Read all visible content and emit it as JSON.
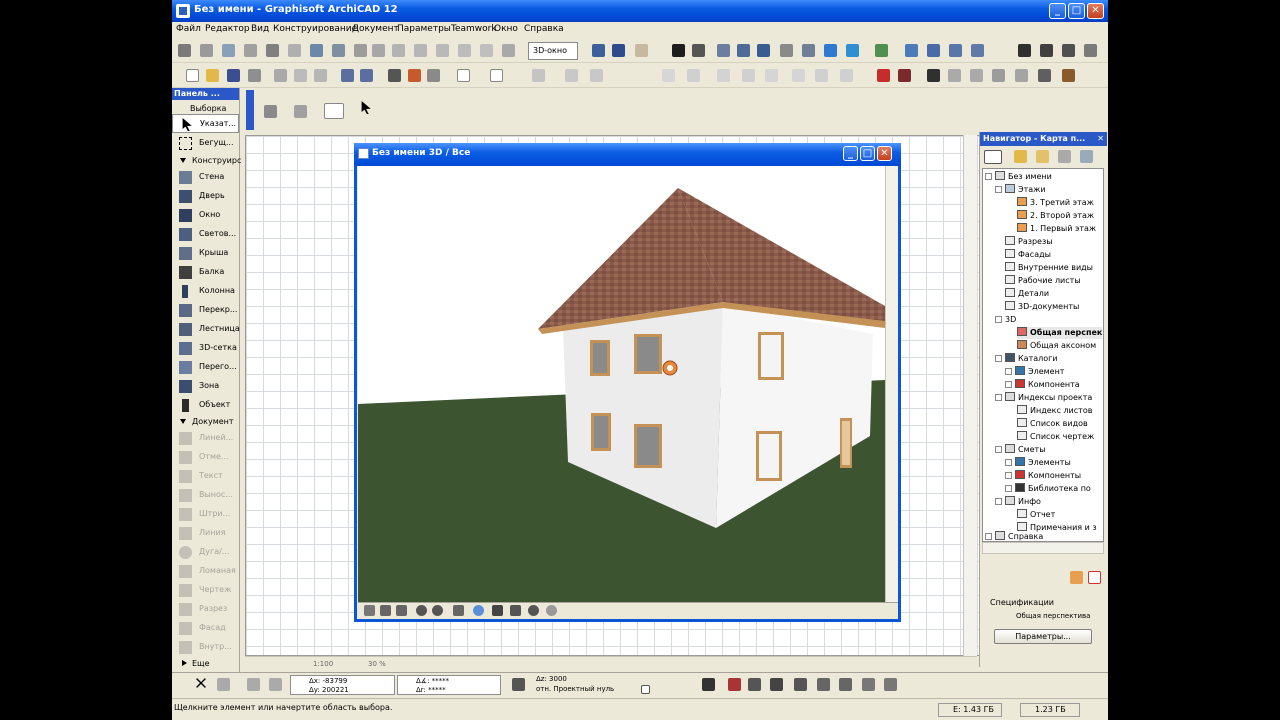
{
  "window": {
    "title": "Без имени - Graphisoft ArchiCAD 12",
    "minimize": "_",
    "maximize": "□",
    "close": "✕"
  },
  "menu": [
    "Файл",
    "Редактор",
    "Вид",
    "Конструирование",
    "Документ",
    "Параметры",
    "Teamwork",
    "Окно",
    "Справка"
  ],
  "toolbar": {
    "view3d_label": "3D-окно"
  },
  "toolbox": {
    "header": "Панель ...",
    "selection_section": "Выборка",
    "pointer": "Указат...",
    "marquee": "Бегущ...",
    "design_section": "Конструирс",
    "design_tools": [
      "Стена",
      "Дверь",
      "Окно",
      "Светов...",
      "Крыша",
      "Балка",
      "Колонна",
      "Перекр...",
      "Лестница",
      "3D-сетка",
      "Перего...",
      "Зона",
      "Объект"
    ],
    "document_section": "Документ",
    "document_tools": [
      "Линей...",
      "Отме...",
      "Текст",
      "Вынос...",
      "Штри...",
      "Линия",
      "Дуга/...",
      "Ломаная",
      "Чертеж",
      "Разрез",
      "Фасад",
      "Внутр..."
    ],
    "more_section": "Еще"
  },
  "window3d": {
    "title": "Без имени 3D / Все",
    "minimize": "_",
    "maximize": "□",
    "close": "✕"
  },
  "plan": {
    "scale": "1:100",
    "zoom": "30 %"
  },
  "navigator": {
    "header": "Навигатор - Карта п...",
    "close": "✕",
    "tree": [
      {
        "label": "Без имени",
        "level": 0
      },
      {
        "label": "Этажи",
        "level": 1
      },
      {
        "label": "3. Третий этаж",
        "level": 2
      },
      {
        "label": "2. Второй этаж",
        "level": 2
      },
      {
        "label": "1. Первый этаж",
        "level": 2
      },
      {
        "label": "Разрезы",
        "level": 1
      },
      {
        "label": "Фасады",
        "level": 1
      },
      {
        "label": "Внутренние виды",
        "level": 1
      },
      {
        "label": "Рабочие листы",
        "level": 1
      },
      {
        "label": "Детали",
        "level": 1
      },
      {
        "label": "3D-документы",
        "level": 1
      },
      {
        "label": "3D",
        "level": 1
      },
      {
        "label": "Общая перспек",
        "level": 2
      },
      {
        "label": "Общая аксоном",
        "level": 2
      },
      {
        "label": "Каталоги",
        "level": 1
      },
      {
        "label": "Элемент",
        "level": 2
      },
      {
        "label": "Компонента",
        "level": 2
      },
      {
        "label": "Индексы проекта",
        "level": 1
      },
      {
        "label": "Индекс листов",
        "level": 2
      },
      {
        "label": "Список видов",
        "level": 2
      },
      {
        "label": "Список чертеж",
        "level": 2
      },
      {
        "label": "Сметы",
        "level": 1
      },
      {
        "label": "Элементы",
        "level": 2
      },
      {
        "label": "Компоненты",
        "level": 2
      },
      {
        "label": "Библиотека по",
        "level": 2
      },
      {
        "label": "Инфо",
        "level": 1
      },
      {
        "label": "Отчет",
        "level": 2
      },
      {
        "label": "Примечания и з",
        "level": 2
      },
      {
        "label": "Справка",
        "level": 0
      }
    ],
    "section_label": "Спецификации",
    "selected_view": "Общая перспектива",
    "params_button": "Параметры..."
  },
  "coords": {
    "dx": "Δx: -83799",
    "dy": "Δy: 200221",
    "da": "Δ∡: *****",
    "dr": "Δr: *****",
    "dz": "Δz: 3000",
    "ref": "отн. Проектный нуль"
  },
  "status": {
    "message": "Щелкните элемент или начертите область выбора.",
    "disk_e": "E: 1.43 ГБ",
    "disk2": "1.23 ГБ"
  },
  "colors": {
    "xp_blue": "#0a57d6",
    "roof": "#8a5a4a",
    "ground": "#3d5430",
    "wall": "#e9e9e9",
    "window_frame": "#c49256"
  }
}
